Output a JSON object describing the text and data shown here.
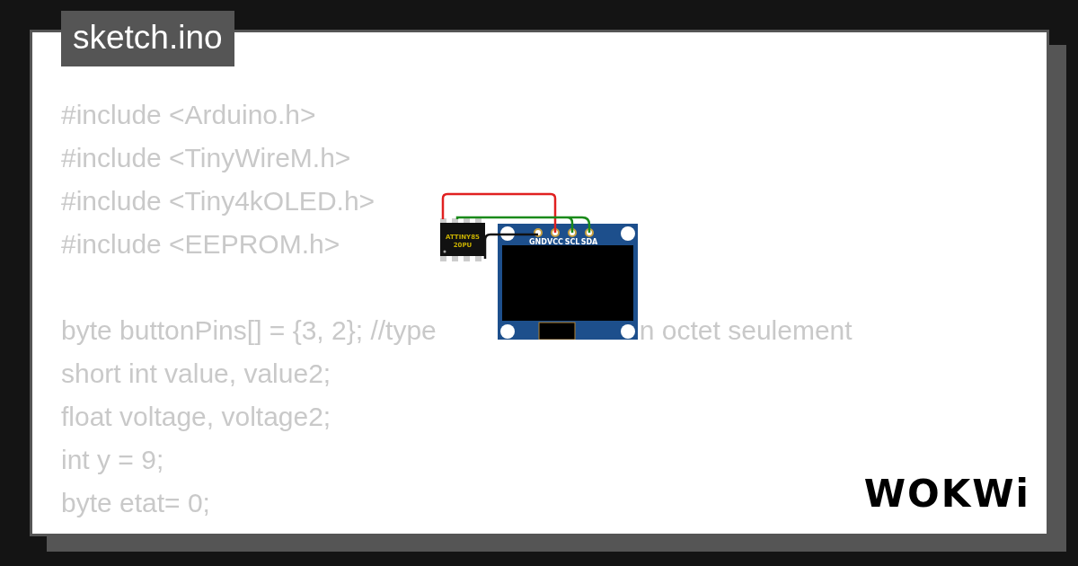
{
  "title": "sketch.ino",
  "code_lines": [
    {
      "kind": "code",
      "segments": [
        "#include <Arduino.h>"
      ]
    },
    {
      "kind": "code",
      "segments": [
        "#include <TinyWireM.h>"
      ]
    },
    {
      "kind": "code",
      "segments": [
        "#include <Tiny4kOLED.h>"
      ]
    },
    {
      "kind": "code",
      "segments": [
        "#include <EEPROM.h>"
      ]
    },
    {
      "kind": "blank"
    },
    {
      "kind": "code",
      "segments": [
        "byte buttonPins[] = {3, 2}; //type",
        "n octet seulement"
      ]
    },
    {
      "kind": "code",
      "segments": [
        "short int value, value2;"
      ]
    },
    {
      "kind": "code",
      "segments": [
        "float voltage, voltage2;"
      ]
    },
    {
      "kind": "code",
      "segments": [
        "int y = 9;"
      ]
    },
    {
      "kind": "code",
      "segments": [
        "byte etat= 0;"
      ]
    }
  ],
  "diagram": {
    "chip_label": [
      "ATTINY85",
      "20PU"
    ],
    "pins": [
      "GND",
      "VCC",
      "SCL",
      "SDA"
    ]
  },
  "logo": "WOKWi"
}
